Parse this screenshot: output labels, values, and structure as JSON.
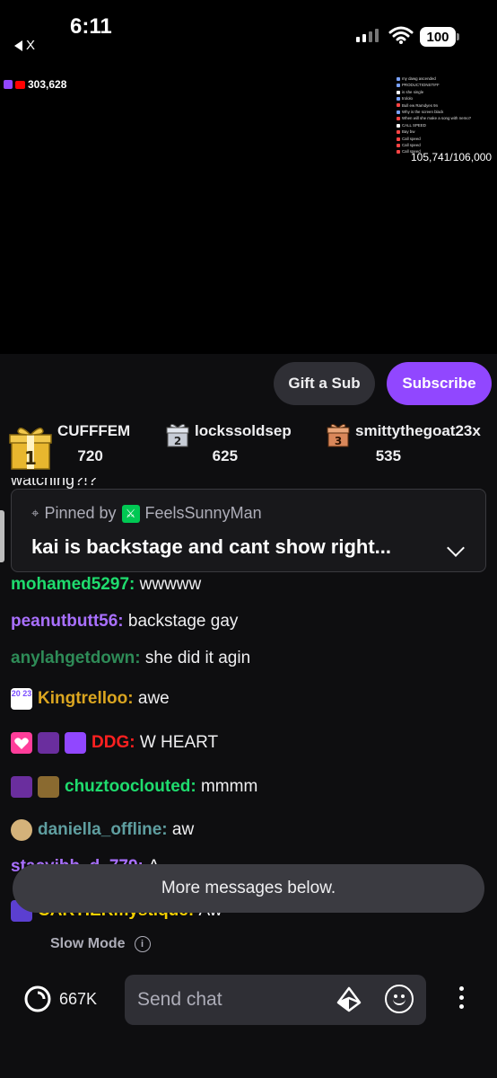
{
  "status_bar": {
    "time": "6:11",
    "back_label": "X",
    "battery": "100"
  },
  "video": {
    "viewer_count": "303,628",
    "goal": "105,741/106,000",
    "mini_chat": [
      {
        "color": "#7aa2ff",
        "text": "my dawg ascended"
      },
      {
        "color": "#7aa2ff",
        "text": "PRODUCTIONSTIFF"
      },
      {
        "color": "#ffffff",
        "text": "is she single"
      },
      {
        "color": "#7aa2ff",
        "text": "trololo"
      },
      {
        "color": "#ff4444",
        "text": "Bull ew Ramdyes 9n"
      },
      {
        "color": "#7aa2ff",
        "text": "Why is the screen black"
      },
      {
        "color": "#ff4444",
        "text": "When will she make a song with nemo?"
      },
      {
        "color": "#ffffff",
        "text": "CALL SPEED"
      },
      {
        "color": "#ff4444",
        "text": "Bay bw"
      },
      {
        "color": "#ff4444",
        "text": "Call speed"
      },
      {
        "color": "#ff4444",
        "text": "Call speed"
      },
      {
        "color": "#ff4444",
        "text": "Call speed"
      }
    ]
  },
  "actions": {
    "gift_label": "Gift a Sub",
    "subscribe_label": "Subscribe"
  },
  "leaderboard": [
    {
      "rank": "1",
      "name": "CUFFFEM",
      "score": "720",
      "color": "#e8b72e"
    },
    {
      "rank": "2",
      "name": "lockssoldsep",
      "score": "625",
      "color": "#c7ccd6"
    },
    {
      "rank": "3",
      "name": "smittythegoat23x",
      "score": "535",
      "color": "#d9875a"
    }
  ],
  "chat": {
    "cutoff_top": "watching?!?",
    "pinned": {
      "prefix": "Pinned by",
      "by": "FeelsSunnyMan",
      "message": "kai is backstage and cant show right..."
    },
    "messages": [
      {
        "user": "mohamed5297:",
        "text": "wwwww",
        "color": "#1fdc6e"
      },
      {
        "user": "peanutbutt56:",
        "text": "backstage gay",
        "color": "#a970ff"
      },
      {
        "user": "anylahgetdown:",
        "text": "she did it agin",
        "color": "#2e8b57"
      },
      {
        "user": "Kingtrelloo:",
        "text": "awe",
        "color": "#daa520"
      },
      {
        "user": "DDG:",
        "text": "W HEART",
        "color": "#ff2020"
      },
      {
        "user": "chuztooclouted:",
        "text": "mmmm",
        "color": "#1fdc6e"
      },
      {
        "user": "daniella_offline:",
        "text": "aw",
        "color": "#5f9ea0"
      },
      {
        "user": "stacyjbh_d_779:",
        "text": "A",
        "color": "#a970ff"
      },
      {
        "user": "CARTIERmystique:",
        "text": "Aw",
        "color": "#f5d000"
      }
    ],
    "badge_sub_label": "20 23"
  },
  "more_messages": "More messages below.",
  "bottom": {
    "slow_mode": "Slow Mode",
    "points": "667K",
    "input_placeholder": "Send chat"
  }
}
